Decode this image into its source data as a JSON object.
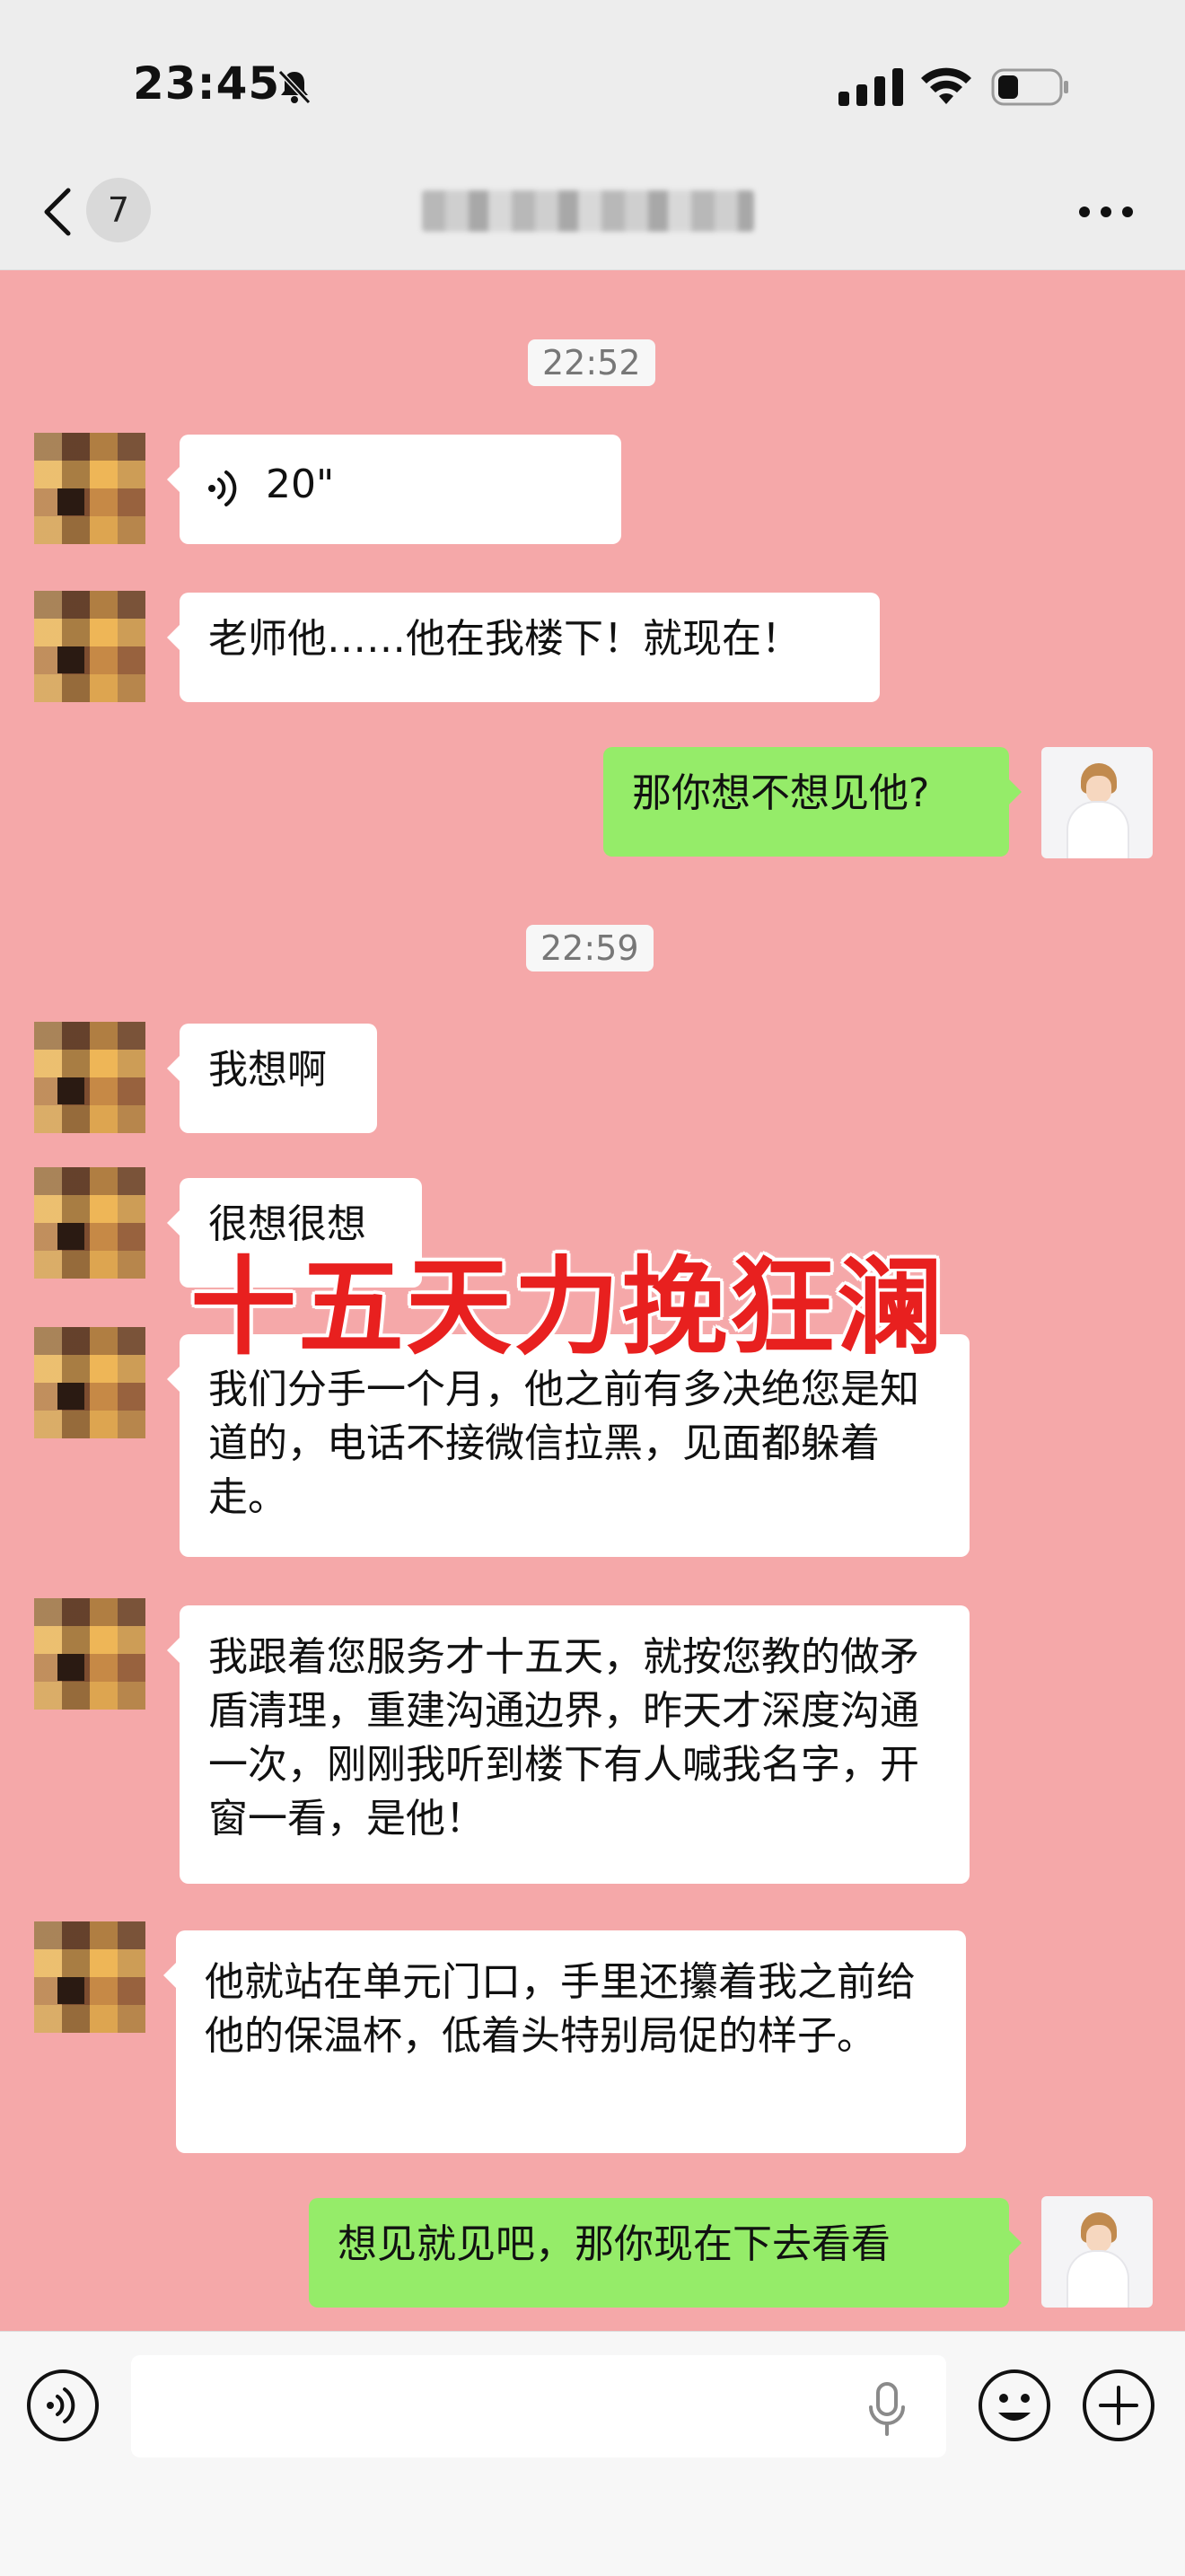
{
  "status_bar": {
    "time": "23:45",
    "icons": [
      "bell-muted-icon",
      "cellular-signal-icon",
      "wifi-icon",
      "battery-icon"
    ]
  },
  "nav": {
    "back_icon": "chevron-left-icon",
    "unread_count": "7",
    "more_icon": "more-dots-icon"
  },
  "chat": {
    "timestamps": [
      "22:52",
      "22:59"
    ],
    "messages": [
      {
        "side": "left",
        "type": "voice",
        "duration": "20\""
      },
      {
        "side": "left",
        "text": "老师他……他在我楼下！就现在！"
      },
      {
        "side": "right",
        "text": "那你想不想见他?"
      },
      {
        "side": "left",
        "text": "我想啊"
      },
      {
        "side": "left",
        "text": "很想很想"
      },
      {
        "side": "left",
        "text": "我们分手一个月，他之前有多决绝您是知道的，电话不接微信拉黑，见面都躲着走。"
      },
      {
        "side": "left",
        "text": "我跟着您服务才十五天，就按您教的做矛盾清理，重建沟通边界，昨天才深度沟通一次，刚刚我听到楼下有人喊我名字，开窗一看，是他！"
      },
      {
        "side": "left",
        "text": "他就站在单元门口，手里还攥着我之前给他的保温杯，低着头特别局促的样子。"
      },
      {
        "side": "right",
        "text": "想见就见吧，那你现在下去看看"
      }
    ]
  },
  "overlay": {
    "title": "十五天力挽狂澜",
    "color": "#e8201f"
  },
  "input_bar": {
    "voice_toggle_icon": "voice-toggle-icon",
    "text_value": "",
    "mic_icon": "microphone-icon",
    "emoji_icon": "emoji-icon",
    "plus_icon": "plus-icon"
  },
  "colors": {
    "chat_background": "#f5a8a9",
    "sent_bubble": "#95ec69",
    "received_bubble": "#ffffff",
    "header": "#ededed"
  }
}
